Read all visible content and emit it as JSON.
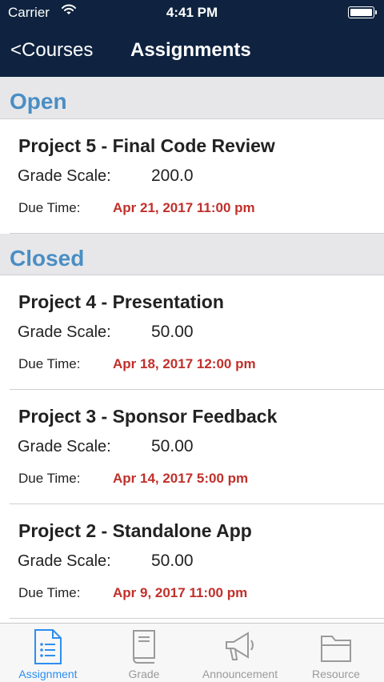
{
  "status_bar": {
    "carrier": "Carrier",
    "time": "4:41 PM",
    "battery_level": 1.0
  },
  "nav": {
    "back_label": "<Courses",
    "title": "Assignments"
  },
  "labels": {
    "grade_scale": "Grade Scale:",
    "due_time": "Due Time:"
  },
  "sections": [
    {
      "header": "Open",
      "assignments": [
        {
          "title": "Project 5 - Final Code Review",
          "grade_scale": "200.0",
          "due_time": "Apr 21, 2017 11:00 pm"
        }
      ]
    },
    {
      "header": "Closed",
      "assignments": [
        {
          "title": "Project 4 - Presentation",
          "grade_scale": "50.00",
          "due_time": "Apr 18, 2017 12:00 pm"
        },
        {
          "title": "Project 3 - Sponsor Feedback",
          "grade_scale": "50.00",
          "due_time": "Apr 14, 2017 5:00 pm"
        },
        {
          "title": "Project 2 - Standalone App",
          "grade_scale": "50.00",
          "due_time": "Apr 9, 2017 11:00 pm"
        }
      ]
    }
  ],
  "tabs": [
    {
      "label": "Assignment",
      "icon": "document-icon",
      "active": true
    },
    {
      "label": "Grade",
      "icon": "book-icon",
      "active": false
    },
    {
      "label": "Announcement",
      "icon": "megaphone-icon",
      "active": false
    },
    {
      "label": "Resource",
      "icon": "folder-icon",
      "active": false
    }
  ],
  "colors": {
    "nav_bg": "#0f2340",
    "section_text": "#4a8ec4",
    "due_text": "#c0302b",
    "active_tab": "#2d8ef0",
    "inactive_tab": "#9a9a9a"
  }
}
